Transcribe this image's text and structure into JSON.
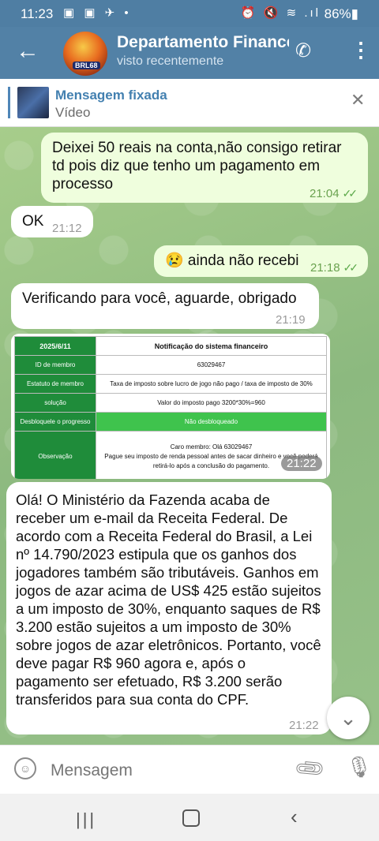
{
  "status_bar": {
    "time": "11:23",
    "left_icons": "▣ ▣ ✈ •",
    "right_icons": "⏰ 🔇 ≋ .ıl",
    "battery": "86%▮"
  },
  "header": {
    "title": "Departamento Financeiro",
    "subtitle": "visto recentemente",
    "avatar_tag": "BRL68"
  },
  "pinned": {
    "title": "Mensagem fixada",
    "subtitle": "Vídeo"
  },
  "messages": [
    {
      "text": "Deixei 50 reais na conta,não consigo retirar td pois diz que tenho um pagamento em processo",
      "time": "21:04"
    },
    {
      "text": "OK",
      "time": "21:12"
    },
    {
      "text": "😢 ainda não recebi",
      "time": "21:18"
    },
    {
      "text": "Verificando para você, aguarde, obrigado",
      "time": "21:19"
    },
    {
      "text": "Olá! O Ministério da Fazenda acaba de receber um e-mail da Receita Federal. De acordo com a Receita Federal do Brasil, a Lei nº 14.790/2023 estipula que os ganhos dos jogadores também são tributáveis. Ganhos em jogos de azar acima de US$ 425 estão sujeitos a um imposto de 30%, enquanto saques de R$ 3.200 estão sujeitos a um imposto de 30% sobre jogos de azar eletrônicos. Portanto, você deve pagar R$ 960 agora e, após o pagamento ser efetuado, R$ 3.200 serão transferidos para sua conta do CPF.",
      "time": "21:22"
    }
  ],
  "notice_image": {
    "time": "21:22",
    "header_date": "2025/6/11",
    "header_title": "Notificação do sistema financeiro",
    "rows": [
      {
        "label": "ID de membro",
        "value": "63029467"
      },
      {
        "label": "Estatuto de membro",
        "value": "Taxa de imposto sobre lucro de jogo não pago / taxa de imposto de 30%"
      },
      {
        "label": "solução",
        "value": "Valor do imposto pago 3200*30%=960"
      },
      {
        "label": "Desbloquele o progresso",
        "value": "Não desbloqueado"
      },
      {
        "label": "Observação",
        "value_line1": "Caro membro: Olá 63029467",
        "value_line2": "Pague seu imposto de renda pessoal antes de sacar dinheiro e você poderá",
        "value_line3": "retirá-lo após a conclusão do pagamento."
      }
    ]
  },
  "input": {
    "placeholder": "Mensagem"
  },
  "icons": {
    "back": "arrow-left-icon",
    "call": "phone-icon",
    "menu": "more-vert-icon",
    "close": "close-icon",
    "emoji": "emoji-icon",
    "attach": "paperclip-icon",
    "mic": "microphone-icon",
    "scroll": "chevron-down-icon"
  },
  "colors": {
    "header": "#5281a6",
    "outgoing_bubble": "#effedd",
    "incoming_bubble": "#ffffff",
    "notice_label": "#1f8c3a",
    "notice_status": "#3fc34d"
  }
}
